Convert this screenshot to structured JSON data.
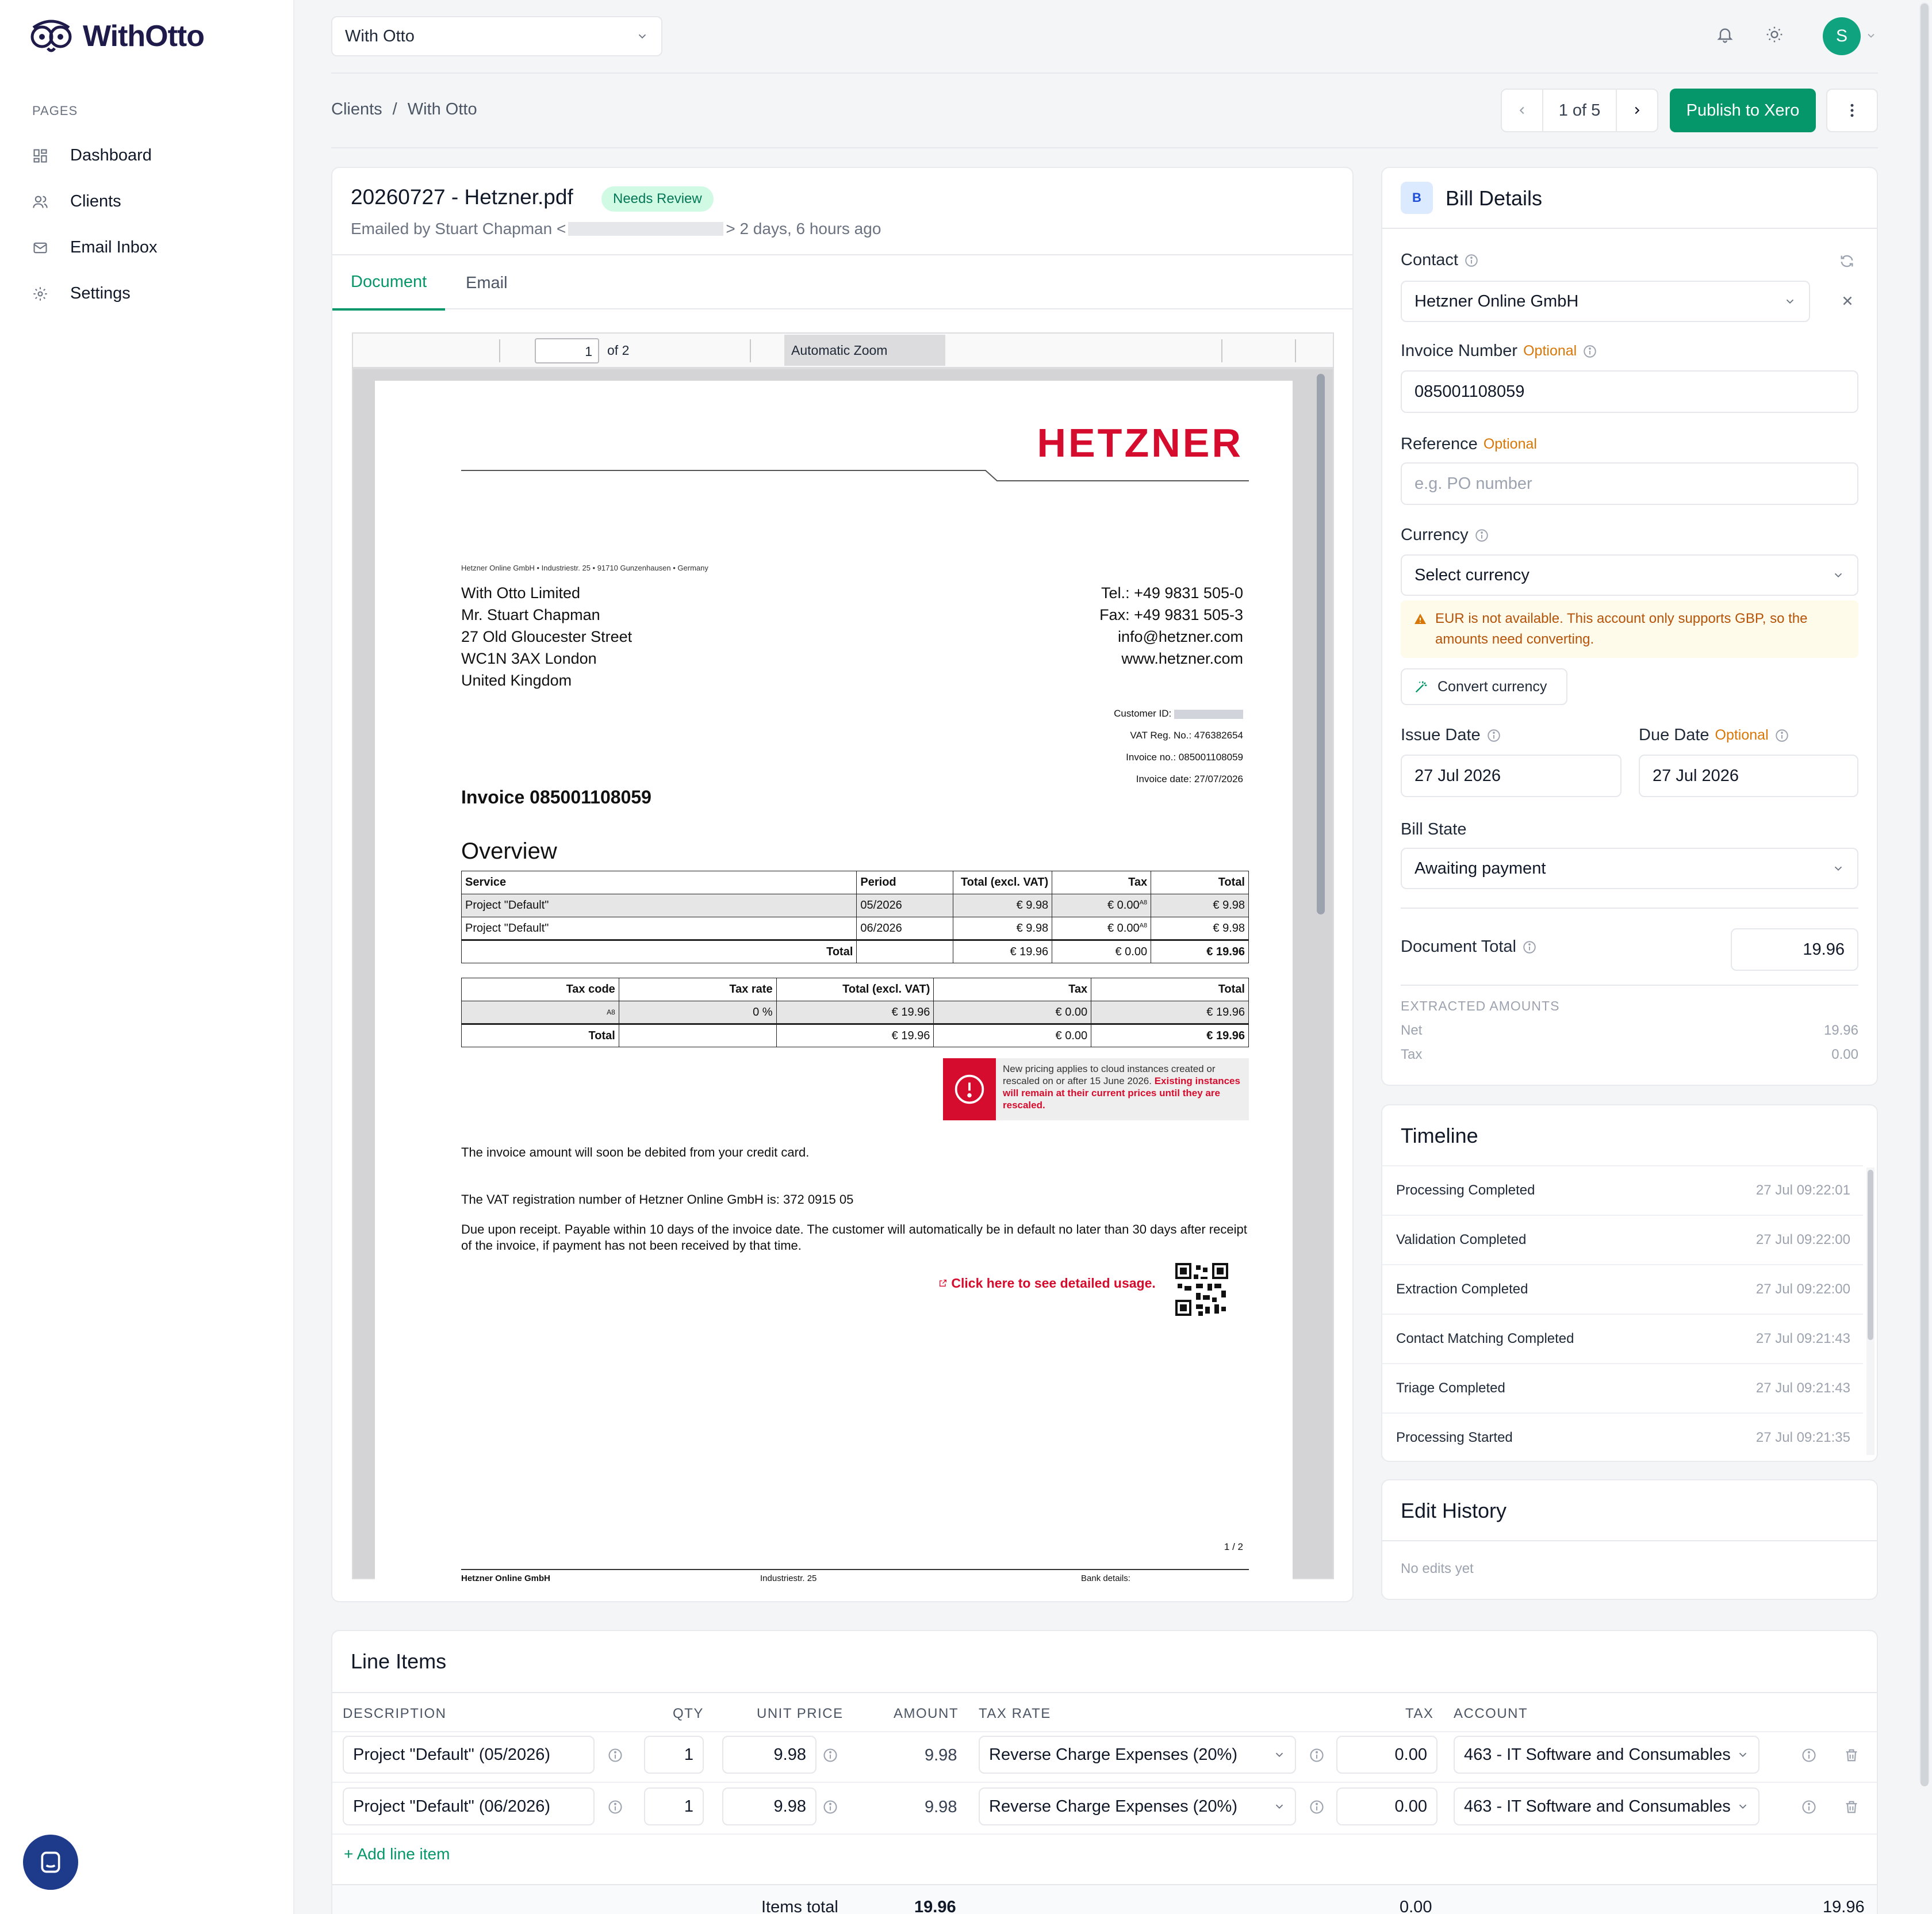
{
  "app": {
    "name": "WithOtto",
    "logo_icon": "owl-logo-icon"
  },
  "sidebar": {
    "section_label": "PAGES",
    "items": [
      {
        "label": "Dashboard",
        "icon": "dashboard-icon"
      },
      {
        "label": "Clients",
        "icon": "users-icon"
      },
      {
        "label": "Email Inbox",
        "icon": "mail-icon"
      },
      {
        "label": "Settings",
        "icon": "gear-icon"
      }
    ]
  },
  "topbar": {
    "org_select": "With Otto",
    "avatar_initial": "S",
    "icons": [
      "bell-icon",
      "sun-icon"
    ]
  },
  "breadcrumb": {
    "items": [
      "Clients",
      "/",
      "With Otto"
    ]
  },
  "pager": {
    "label": "1 of 5"
  },
  "publish_label": "Publish to Xero",
  "document": {
    "title": "20260727 - Hetzner.pdf",
    "status": "Needs Review",
    "meta_prefix": "Emailed by Stuart Chapman <",
    "meta_suffix": "> 2 days, 6 hours ago",
    "tabs": [
      "Document",
      "Email"
    ],
    "pdf_toolbar": {
      "page": "1",
      "of": "of 2",
      "zoom": "Automatic Zoom"
    }
  },
  "invoice": {
    "brand": "HETZNER",
    "sender_line": "Hetzner Online GmbH • Industriestr. 25 • 91710 Gunzenhausen • Germany",
    "address": [
      "With Otto Limited",
      "Mr. Stuart Chapman",
      "27 Old Gloucester Street",
      "WC1N 3AX London",
      "United Kingdom"
    ],
    "contact": [
      "Tel.: +49 9831 505-0",
      "Fax: +49 9831 505-3",
      "info@hetzner.com",
      "www.hetzner.com"
    ],
    "meta": {
      "customer_id": "Customer ID:",
      "vat_reg": "VAT Reg. No.: 476382654",
      "invoice_no": "Invoice no.: 085001108059",
      "invoice_date": "Invoice date: 27/07/2026"
    },
    "title": "Invoice 085001108059",
    "overview_label": "Overview",
    "overview_headers": [
      "Service",
      "Period",
      "Total (excl. VAT)",
      "Tax",
      "Total"
    ],
    "overview_rows": [
      [
        "Project \"Default\"",
        "05/2026",
        "€ 9.98",
        "€ 0.00",
        "€ 9.98"
      ],
      [
        "Project \"Default\"",
        "06/2026",
        "€ 9.98",
        "€ 0.00",
        "€ 9.98"
      ]
    ],
    "tax_superscript": "A8",
    "overview_total": [
      "Total",
      "",
      "€ 19.96",
      "€ 0.00",
      "€ 19.96"
    ],
    "tax_headers": [
      "Tax code",
      "Tax rate",
      "Total (excl. VAT)",
      "Tax",
      "Total"
    ],
    "tax_rows": [
      [
        "A8",
        "0 %",
        "€ 19.96",
        "€ 0.00",
        "€ 19.96"
      ]
    ],
    "tax_total": [
      "Total",
      "",
      "€ 19.96",
      "€ 0.00",
      "€ 19.96"
    ],
    "notice_normal": "New pricing applies to cloud instances created or rescaled on or after 15 June 2026.",
    "notice_red": "Existing instances will remain at their current prices until they are rescaled.",
    "para1": "The invoice amount will soon be debited from your credit card.",
    "para2": "The VAT registration number of Hetzner Online GmbH is: 372 0915 05",
    "para3": "Due upon receipt. Payable within 10 days of the invoice date. The customer will automatically be in default no later than 30 days after receipt of the invoice, if payment has not been received by that time.",
    "usage_link": "Click here to see detailed usage.",
    "page_num": "1 / 2",
    "footer": [
      "Hetzner Online GmbH",
      "Industriestr. 25",
      "Bank details:"
    ]
  },
  "bill": {
    "badge": "B",
    "title": "Bill Details",
    "contact_label": "Contact",
    "contact_value": "Hetzner Online GmbH",
    "invoice_number_label": "Invoice Number",
    "optional": "Optional",
    "invoice_number_value": "085001108059",
    "reference_label": "Reference",
    "reference_placeholder": "e.g. PO number",
    "currency_label": "Currency",
    "currency_value": "Select currency",
    "currency_warning": "EUR is not available. This account only supports GBP, so the amounts need converting.",
    "convert_label": "Convert currency",
    "issue_date_label": "Issue Date",
    "issue_date_value": "27 Jul 2026",
    "due_date_label": "Due Date",
    "due_date_value": "27 Jul 2026",
    "bill_state_label": "Bill State",
    "bill_state_value": "Awaiting payment",
    "document_total_label": "Document Total",
    "document_total_value": "19.96",
    "extracted_label": "EXTRACTED AMOUNTS",
    "net_label": "Net",
    "net_value": "19.96",
    "tax_label": "Tax",
    "tax_value": "0.00"
  },
  "timeline": {
    "title": "Timeline",
    "events": [
      {
        "label": "Processing Completed",
        "time": "27 Jul 09:22:01"
      },
      {
        "label": "Validation Completed",
        "time": "27 Jul 09:22:00"
      },
      {
        "label": "Extraction Completed",
        "time": "27 Jul 09:22:00"
      },
      {
        "label": "Contact Matching Completed",
        "time": "27 Jul 09:21:43"
      },
      {
        "label": "Triage Completed",
        "time": "27 Jul 09:21:43"
      },
      {
        "label": "Processing Started",
        "time": "27 Jul 09:21:35"
      }
    ]
  },
  "edit_history": {
    "title": "Edit History",
    "empty": "No edits yet"
  },
  "line_items": {
    "title": "Line Items",
    "headers": [
      "DESCRIPTION",
      "QTY",
      "UNIT PRICE",
      "AMOUNT",
      "TAX RATE",
      "TAX",
      "ACCOUNT"
    ],
    "rows": [
      {
        "description": "Project \"Default\" (05/2026)",
        "qty": "1",
        "unit_price": "9.98",
        "amount": "9.98",
        "tax_rate": "Reverse Charge Expenses (20%)",
        "tax": "0.00",
        "account": "463 - IT Software and Consumables"
      },
      {
        "description": "Project \"Default\" (06/2026)",
        "qty": "1",
        "unit_price": "9.98",
        "amount": "9.98",
        "tax_rate": "Reverse Charge Expenses (20%)",
        "tax": "0.00",
        "account": "463 - IT Software and Consumables"
      }
    ],
    "add_label": "+ Add line item",
    "totals_label": "Items total",
    "totals_amount": "19.96",
    "totals_tax": "0.00",
    "totals_total": "19.96"
  },
  "colors": {
    "accent": "#059669",
    "brand_red": "#d50c2d",
    "warning": "#d97706"
  }
}
